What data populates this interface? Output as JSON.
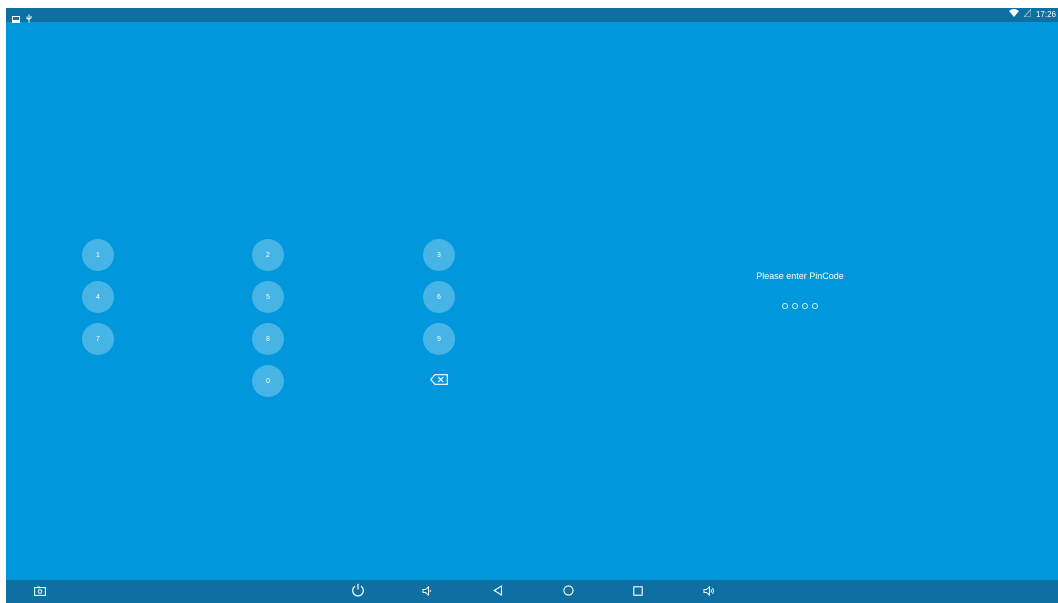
{
  "status_bar": {
    "left_icons": [
      "screenshot-notification-icon",
      "usb-icon"
    ],
    "right_icons": [
      "wifi-icon",
      "signal-icon"
    ],
    "time": "17:26"
  },
  "keypad": {
    "keys": [
      "1",
      "2",
      "3",
      "4",
      "5",
      "6",
      "7",
      "8",
      "9",
      "0"
    ],
    "backspace_icon": "backspace-icon"
  },
  "pin": {
    "prompt": "Please enter PinCode",
    "length": 4,
    "entered": 0
  },
  "nav_bar": {
    "buttons": [
      "screenshot-icon",
      "power-icon",
      "volume-down-icon",
      "back-icon",
      "home-icon",
      "recents-icon",
      "volume-up-icon"
    ]
  },
  "colors": {
    "background": "#0097DD",
    "bars": "#0E6FA3",
    "key_fill": "rgba(255,255,255,0.28)",
    "foreground": "#FFFFFF"
  }
}
